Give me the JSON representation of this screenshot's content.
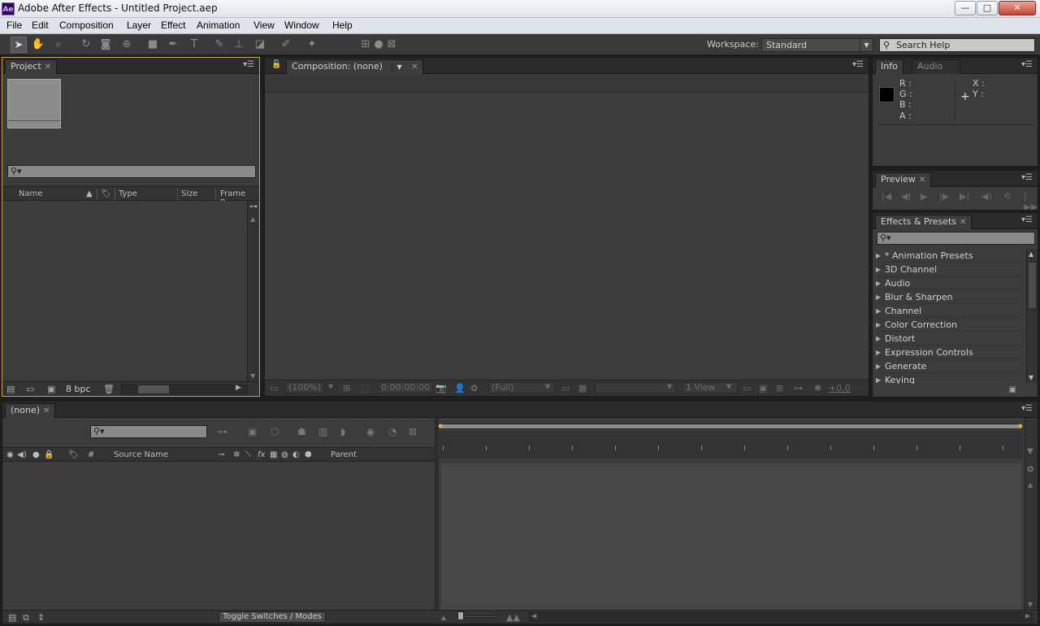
{
  "app": {
    "title": "Adobe After Effects - Untitled Project.aep",
    "logo_text": "Ae"
  },
  "window_controls": {
    "minimize": "—",
    "maximize": "□",
    "close": "✕"
  },
  "menu": [
    "File",
    "Edit",
    "Composition",
    "Layer",
    "Effect",
    "Animation",
    "View",
    "Window",
    "Help"
  ],
  "toolbar": {
    "workspace_label": "Workspace:",
    "workspace_value": "Standard",
    "search_placeholder": "Search Help"
  },
  "project_panel": {
    "tab_label": "Project",
    "columns": [
      "Name",
      "Type",
      "Size",
      "Frame R..."
    ],
    "bit_depth": "8 bpc"
  },
  "composition_panel": {
    "tab_label": "Composition: (none)",
    "footer": {
      "zoom": "(100%)",
      "timecode": "0:00:00:00",
      "resolution": "(Full)",
      "views": "1 View",
      "exposure": "+0,0"
    }
  },
  "info_panel": {
    "tabs": [
      "Info",
      "Audio"
    ],
    "rgba": [
      "R :",
      "G :",
      "B :",
      "A :"
    ],
    "xy": [
      "X :",
      "Y :"
    ],
    "swatch_color": "#000000"
  },
  "preview_panel": {
    "tab_label": "Preview"
  },
  "effects_panel": {
    "tab_label": "Effects & Presets",
    "items": [
      "* Animation Presets",
      "3D Channel",
      "Audio",
      "Blur & Sharpen",
      "Channel",
      "Color Correction",
      "Distort",
      "Expression Controls",
      "Generate",
      "Keying"
    ]
  },
  "timeline_panel": {
    "tab_label": "(none)",
    "columns": {
      "number": "#",
      "source_name": "Source Name",
      "parent": "Parent"
    },
    "toggle_button": "Toggle Switches / Modes"
  },
  "colors": {
    "panel_bg": "#3c3c3c",
    "active_panel_border": "#c7a13a",
    "menubar_bg": "#dfe3ea"
  }
}
